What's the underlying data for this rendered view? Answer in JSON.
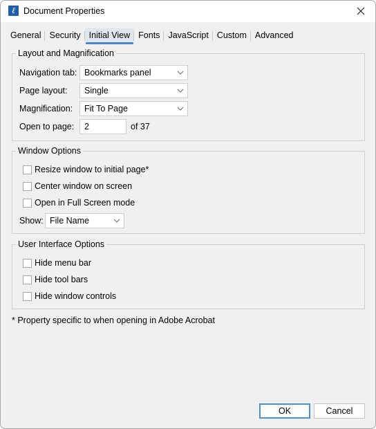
{
  "window": {
    "title": "Document Properties",
    "app_icon_glyph": "ℓ",
    "close_icon": "close-icon"
  },
  "tabs": [
    {
      "label": "General",
      "active": false
    },
    {
      "label": "Security",
      "active": false
    },
    {
      "label": "Initial View",
      "active": true
    },
    {
      "label": "Fonts",
      "active": false
    },
    {
      "label": "JavaScript",
      "active": false
    },
    {
      "label": "Custom",
      "active": false
    },
    {
      "label": "Advanced",
      "active": false
    }
  ],
  "layout_group": {
    "title": "Layout and Magnification",
    "navigation_tab": {
      "label": "Navigation tab:",
      "value": "Bookmarks panel"
    },
    "page_layout": {
      "label": "Page layout:",
      "value": "Single"
    },
    "magnification": {
      "label": "Magnification:",
      "value": "Fit To Page"
    },
    "open_to_page": {
      "label": "Open to page:",
      "value": "2",
      "of_text": "of 37"
    }
  },
  "window_group": {
    "title": "Window Options",
    "checkboxes": [
      {
        "label": "Resize window to initial page*",
        "checked": false
      },
      {
        "label": "Center window on screen",
        "checked": false
      },
      {
        "label": "Open in Full Screen mode",
        "checked": false
      }
    ],
    "show": {
      "label": "Show:",
      "value": "File Name"
    }
  },
  "ui_group": {
    "title": "User Interface Options",
    "checkboxes": [
      {
        "label": "Hide menu bar",
        "checked": false
      },
      {
        "label": "Hide tool bars",
        "checked": false
      },
      {
        "label": "Hide window controls",
        "checked": false
      }
    ]
  },
  "footnote": "* Property specific to when opening in Adobe Acrobat",
  "buttons": {
    "ok": "OK",
    "cancel": "Cancel"
  },
  "colors": {
    "accent": "#4a86c8",
    "app_icon": "#1f5fa8"
  }
}
